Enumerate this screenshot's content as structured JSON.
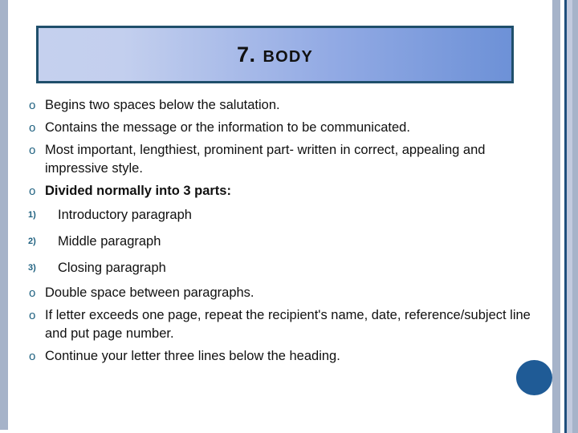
{
  "slide": {
    "title": {
      "number": "7.",
      "word": "BODY"
    },
    "items": [
      {
        "marker": "o",
        "type": "bullet",
        "bold": false,
        "text": "Begins two spaces below the salutation."
      },
      {
        "marker": "o",
        "type": "bullet",
        "bold": false,
        "text": "Contains the message or the information to be communicated."
      },
      {
        "marker": "o",
        "type": "bullet",
        "bold": false,
        "text": "Most important, lengthiest, prominent part- written in correct, appealing and impressive style."
      },
      {
        "marker": "o",
        "type": "bullet",
        "bold": true,
        "text": "Divided normally into 3 parts:"
      },
      {
        "marker": "1)",
        "type": "numbered",
        "bold": false,
        "text": "Introductory paragraph"
      },
      {
        "marker": "2)",
        "type": "numbered",
        "bold": false,
        "text": "Middle paragraph"
      },
      {
        "marker": "3)",
        "type": "numbered",
        "bold": false,
        "text": "Closing paragraph"
      },
      {
        "marker": "o",
        "type": "bullet",
        "bold": false,
        "text": "Double space between paragraphs."
      },
      {
        "marker": "o",
        "type": "bullet",
        "bold": false,
        "text": "If letter exceeds one page, repeat the recipient's name, date, reference/subject line and put page number."
      },
      {
        "marker": "o",
        "type": "bullet",
        "bold": false,
        "text": "Continue your letter three lines below the heading."
      }
    ],
    "colors": {
      "title_border": "#1f4f6b",
      "title_gradient_start": "#c5d0ee",
      "title_gradient_end": "#6d91d7",
      "bullet_marker": "#1f6180",
      "edge_bar": "#a6b3c9",
      "edge_line": "#1f4f7d",
      "corner_circle": "#1f5b96",
      "body_text": "#101010"
    }
  }
}
